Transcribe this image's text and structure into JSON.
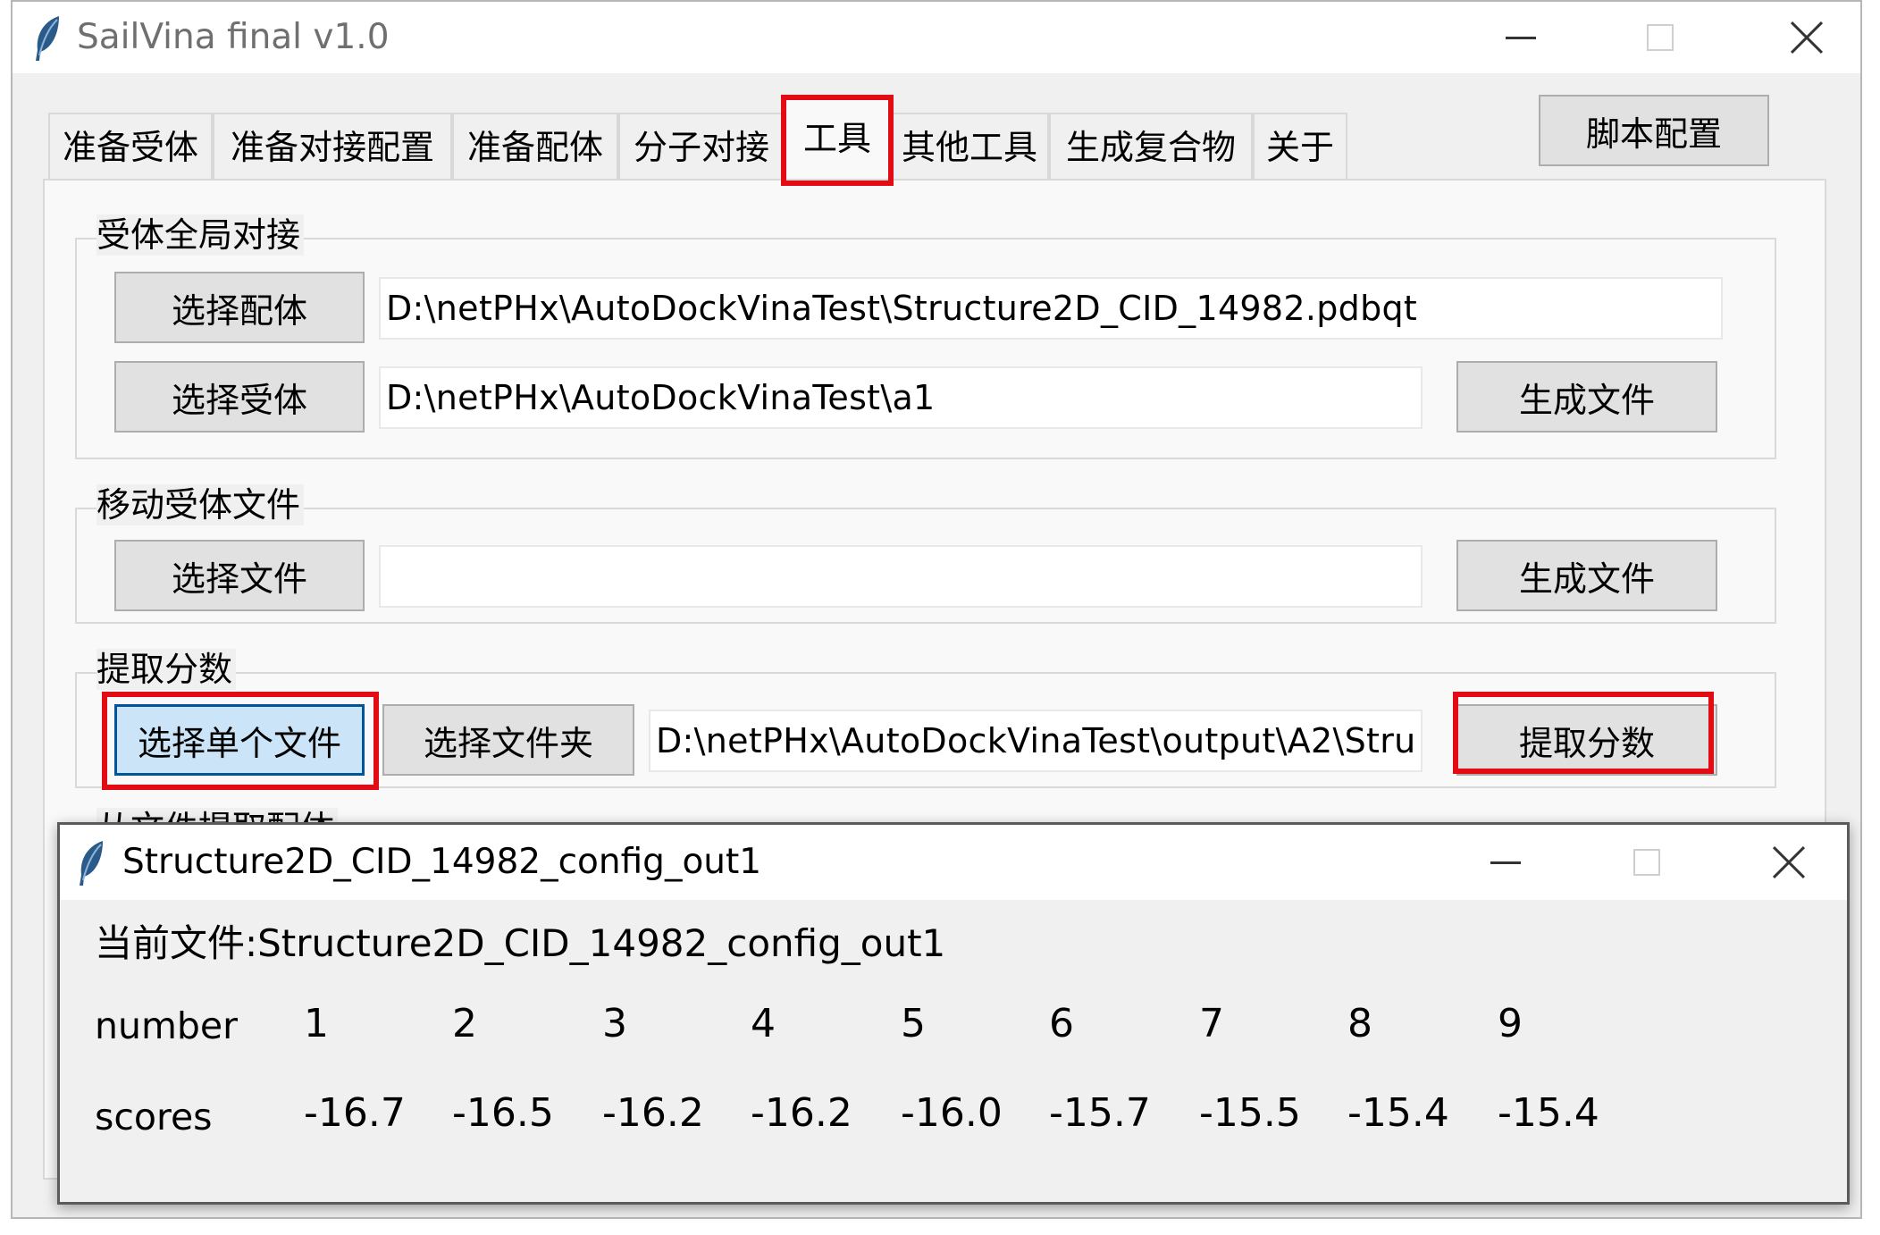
{
  "main_window": {
    "title": "SailVina final v1.0",
    "app_icon": "feather-icon"
  },
  "tabs": [
    {
      "label": "准备受体"
    },
    {
      "label": "准备对接配置"
    },
    {
      "label": "准备配体"
    },
    {
      "label": "分子对接"
    },
    {
      "label": "工具"
    },
    {
      "label": "其他工具"
    },
    {
      "label": "生成复合物"
    },
    {
      "label": "关于"
    }
  ],
  "active_tab": "工具",
  "script_config_button": "脚本配置",
  "section_global_docking": {
    "title": "受体全局对接",
    "select_ligand_button": "选择配体",
    "ligand_path": "D:\\netPHx\\AutoDockVinaTest\\Structure2D_CID_14982.pdbqt",
    "select_receptor_button": "选择受体",
    "receptor_path": "D:\\netPHx\\AutoDockVinaTest\\a1",
    "generate_button": "生成文件"
  },
  "section_move_receptor": {
    "title": "移动受体文件",
    "select_file_button": "选择文件",
    "file_path": "",
    "generate_button": "生成文件"
  },
  "section_extract_scores": {
    "title": "提取分数",
    "select_single_file_button": "选择单个文件",
    "select_folder_button": "选择文件夹",
    "path": "D:\\netPHx\\AutoDockVinaTest\\output\\A2\\Stru",
    "extract_button": "提取分数"
  },
  "section_next_partial": {
    "title": "从文件提取配体"
  },
  "popup": {
    "title": "Structure2D_CID_14982_config_out1",
    "current_file_text": "当前文件:Structure2D_CID_14982_config_out1",
    "number_label": "number",
    "numbers": [
      "1",
      "2",
      "3",
      "4",
      "5",
      "6",
      "7",
      "8",
      "9"
    ],
    "scores_label": "scores",
    "scores": [
      "-16.7",
      "-16.5",
      "-16.2",
      "-16.2",
      "-16.0",
      "-15.7",
      "-15.5",
      "-15.4",
      "-15.4"
    ]
  },
  "colors": {
    "highlight_red": "#e30b14",
    "selected_button_bg": "#cce4f7",
    "window_bg": "#f0f0f0"
  }
}
